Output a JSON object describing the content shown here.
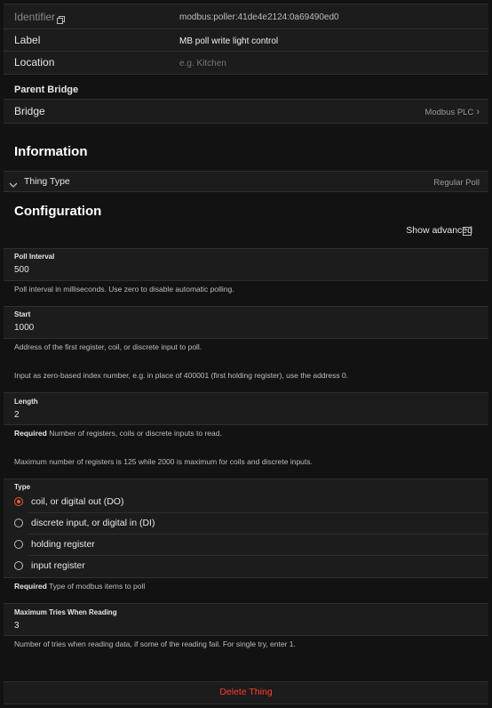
{
  "thing": {
    "identifier_label": "Identifier",
    "identifier_value": "modbus:poller:41de4e2124:0a69490ed0",
    "label_label": "Label",
    "label_value": "MB poll write light control",
    "location_label": "Location",
    "location_placeholder": "e.g. Kitchen"
  },
  "parent_bridge": {
    "title": "Parent Bridge",
    "bridge_label": "Bridge",
    "bridge_value": "Modbus PLC"
  },
  "information": {
    "title": "Information",
    "thing_type_label": "Thing Type",
    "thing_type_value": "Regular Poll"
  },
  "configuration": {
    "title": "Configuration",
    "show_advanced_label": "Show advanced",
    "poll_interval": {
      "label": "Poll Interval",
      "value": "500",
      "hint": "Poll interval in milliseconds. Use zero to disable automatic polling."
    },
    "start": {
      "label": "Start",
      "value": "1000",
      "hint1": "Address of the first register, coil, or discrete input to poll.",
      "hint2": "Input as zero-based index number, e.g. in place of 400001 (first holding register), use the address 0."
    },
    "length": {
      "label": "Length",
      "value": "2",
      "required": "Required",
      "hint1": "Number of registers, coils or discrete inputs to read.",
      "hint2": "Maximum number of registers is 125 while 2000 is maximum for coils and discrete inputs."
    },
    "type": {
      "label": "Type",
      "options": [
        {
          "label": "coil, or digital out (DO)",
          "selected": true
        },
        {
          "label": "discrete input, or digital in (DI)",
          "selected": false
        },
        {
          "label": "holding register",
          "selected": false
        },
        {
          "label": "input register",
          "selected": false
        }
      ],
      "required": "Required",
      "hint": "Type of modbus items to poll"
    },
    "max_tries": {
      "label": "Maximum Tries When Reading",
      "value": "3",
      "hint": "Number of tries when reading data, if some of the reading fail. For single try, enter 1."
    }
  },
  "delete_label": "Delete Thing",
  "colors": {
    "accent": "#e85b36",
    "danger": "#ff3b30",
    "background": "#121212",
    "card": "#1c1c1c"
  }
}
